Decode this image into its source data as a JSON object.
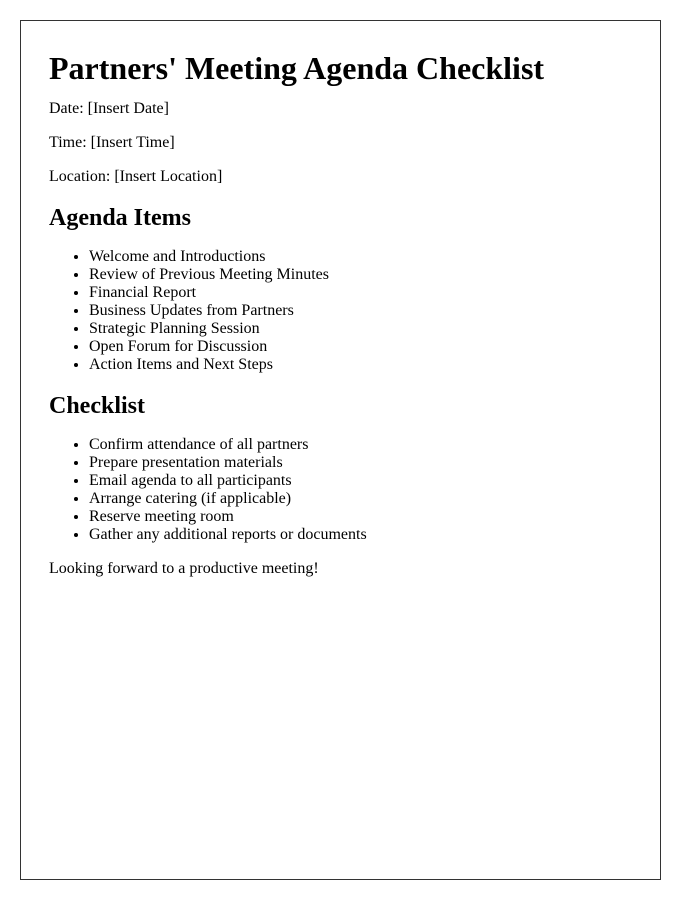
{
  "title": "Partners' Meeting Agenda Checklist",
  "details": {
    "date": "Date: [Insert Date]",
    "time": "Time: [Insert Time]",
    "location": "Location: [Insert Location]"
  },
  "agenda": {
    "heading": "Agenda Items",
    "items": [
      "Welcome and Introductions",
      "Review of Previous Meeting Minutes",
      "Financial Report",
      "Business Updates from Partners",
      "Strategic Planning Session",
      "Open Forum for Discussion",
      "Action Items and Next Steps"
    ]
  },
  "checklist": {
    "heading": "Checklist",
    "items": [
      "Confirm attendance of all partners",
      "Prepare presentation materials",
      "Email agenda to all participants",
      "Arrange catering (if applicable)",
      "Reserve meeting room",
      "Gather any additional reports or documents"
    ]
  },
  "closing": "Looking forward to a productive meeting!"
}
